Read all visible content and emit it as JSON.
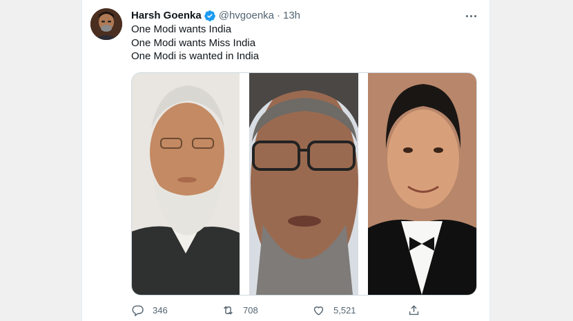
{
  "tweet": {
    "author_name": "Harsh Goenka",
    "handle": "@hvgoenka",
    "separator": "·",
    "time": "13h",
    "lines": [
      "One Modi wants India",
      "One Modi wants Miss India",
      "One Modi is wanted in India"
    ],
    "icons": {
      "verified": "verified-badge-icon",
      "more": "more-options-icon",
      "reply": "reply-icon",
      "retweet": "retweet-icon",
      "like": "like-icon",
      "share": "share-icon"
    },
    "actions": {
      "reply_count": "346",
      "retweet_count": "708",
      "like_count": "5,521"
    },
    "colors": {
      "verified": "#1d9bf0",
      "secondary_text": "#536471",
      "primary_text": "#0f1419"
    }
  }
}
